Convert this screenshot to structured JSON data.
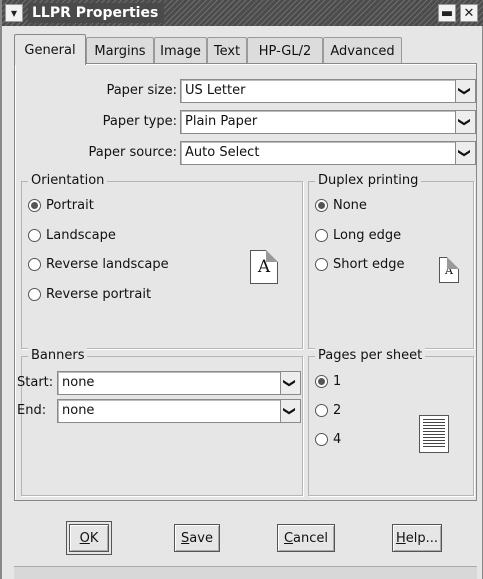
{
  "window": {
    "title": "LLPR Properties",
    "menu_glyph": "▾",
    "minimize_glyph": "▬",
    "close_glyph": "✕"
  },
  "tabs": [
    {
      "label": "General",
      "active": true
    },
    {
      "label": "Margins",
      "active": false
    },
    {
      "label": "Image",
      "active": false
    },
    {
      "label": "Text",
      "active": false
    },
    {
      "label": "HP-GL/2",
      "active": false
    },
    {
      "label": "Advanced",
      "active": false
    }
  ],
  "general": {
    "paper_size": {
      "label": "Paper size:",
      "value": "US Letter"
    },
    "paper_type": {
      "label": "Paper type:",
      "value": "Plain Paper"
    },
    "paper_source": {
      "label": "Paper source:",
      "value": "Auto Select"
    }
  },
  "orientation": {
    "legend": "Orientation",
    "options": [
      "Portrait",
      "Landscape",
      "Reverse landscape",
      "Reverse portrait"
    ],
    "selected": "Portrait",
    "preview_glyph": "A"
  },
  "duplex": {
    "legend": "Duplex printing",
    "options": [
      "None",
      "Long edge",
      "Short edge"
    ],
    "selected": "None",
    "preview_glyph": "A"
  },
  "banners": {
    "legend": "Banners",
    "start": {
      "label": "Start:",
      "value": "none"
    },
    "end": {
      "label": "End:",
      "value": "none"
    }
  },
  "pages_per_sheet": {
    "legend": "Pages per sheet",
    "options": [
      "1",
      "2",
      "4"
    ],
    "selected": "1"
  },
  "buttons": {
    "ok": {
      "mnemonic": "O",
      "rest": "K"
    },
    "save": {
      "mnemonic": "S",
      "rest": "ave"
    },
    "cancel": {
      "mnemonic": "C",
      "rest": "ancel"
    },
    "help": {
      "mnemonic": "H",
      "rest": "elp..."
    }
  },
  "icons": {
    "dropdown_arrow": "❯"
  }
}
